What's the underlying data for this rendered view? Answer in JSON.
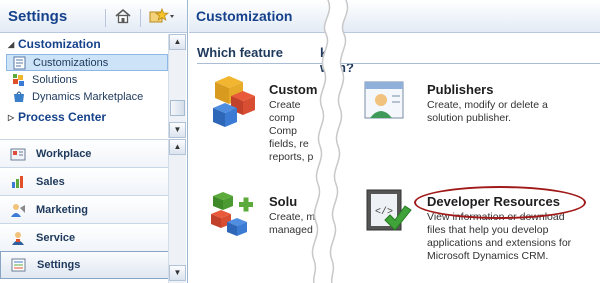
{
  "nav": {
    "title": "Settings",
    "tree": {
      "group1": "Customization",
      "items": [
        {
          "label": "Customizations",
          "selected": true,
          "icon": "customizations-icon"
        },
        {
          "label": "Solutions",
          "selected": false,
          "icon": "solutions-icon"
        },
        {
          "label": "Dynamics Marketplace",
          "selected": false,
          "icon": "marketplace-icon"
        }
      ],
      "group2": "Process Center"
    },
    "wunderbar": [
      {
        "label": "Workplace",
        "icon": "workplace-icon"
      },
      {
        "label": "Sales",
        "icon": "sales-icon"
      },
      {
        "label": "Marketing",
        "icon": "marketing-icon"
      },
      {
        "label": "Service",
        "icon": "service-icon"
      },
      {
        "label": "Settings",
        "icon": "settings-icon",
        "selected": true
      }
    ]
  },
  "main": {
    "title": "Customization",
    "question_left": "Which feature",
    "question_right": "k with?",
    "tiles": {
      "customize": {
        "title": "Custom",
        "desc": [
          "Create",
          "comp",
          "Comp",
          "fields, re",
          "reports, p"
        ]
      },
      "publishers": {
        "title": "Publishers",
        "desc": [
          "Create, modify or delete a",
          "solution publisher."
        ]
      },
      "solutions": {
        "title": "Solu",
        "desc": [
          "Create, m",
          "managed"
        ]
      },
      "developer": {
        "title": "Developer Resources",
        "desc": [
          "View information or download",
          "files that help you develop",
          "applications and extensions for",
          "Microsoft Dynamics CRM."
        ]
      }
    }
  },
  "colors": {
    "accent": "#15428b",
    "highlight": "#a11a1a"
  }
}
